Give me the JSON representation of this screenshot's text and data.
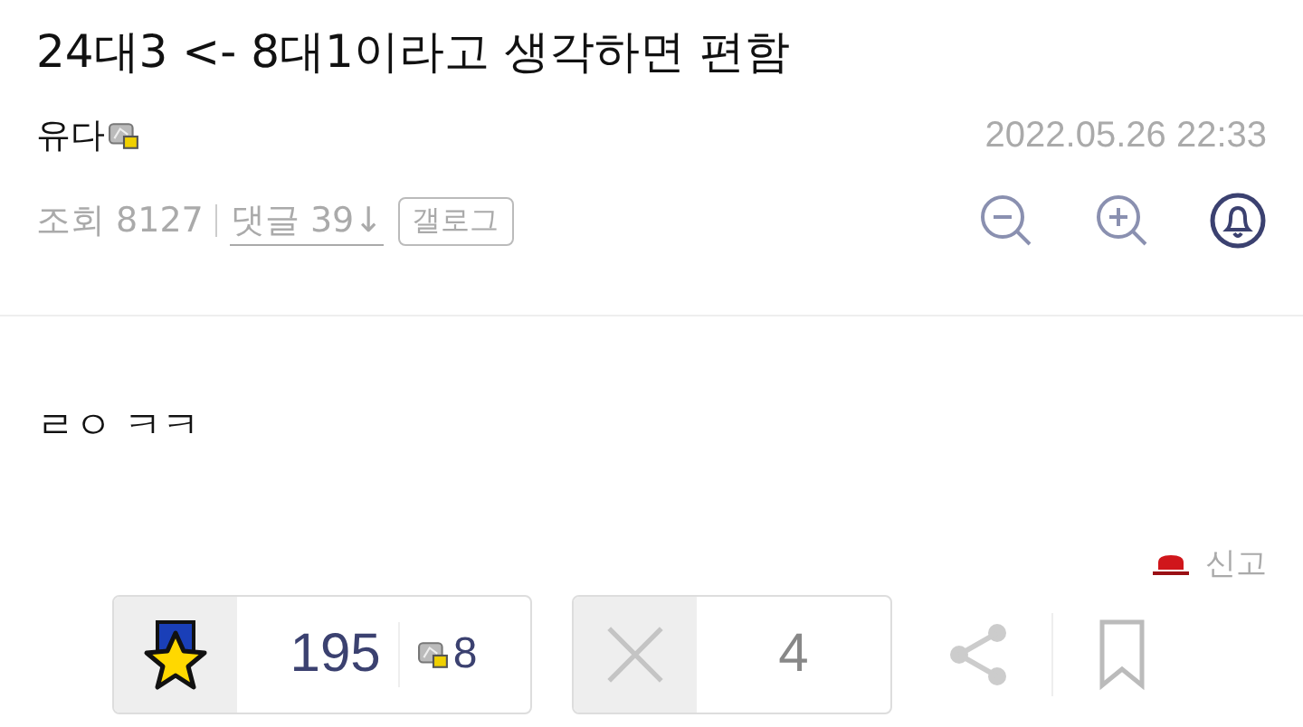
{
  "post": {
    "title": "24대3 <- 8대1이라고 생각하면 편함",
    "author": "유다",
    "date": "2022.05.26 22:33",
    "views_label": "조회",
    "views": "8127",
    "comments_label": "댓글",
    "comments": "39",
    "comments_arrow": "↓",
    "gallog": "갤로그"
  },
  "body": "ㄹㅇ ㅋㅋ",
  "report": "신고",
  "recommend": {
    "count": "195",
    "fixed_count": "8"
  },
  "decline": {
    "count": "4"
  }
}
